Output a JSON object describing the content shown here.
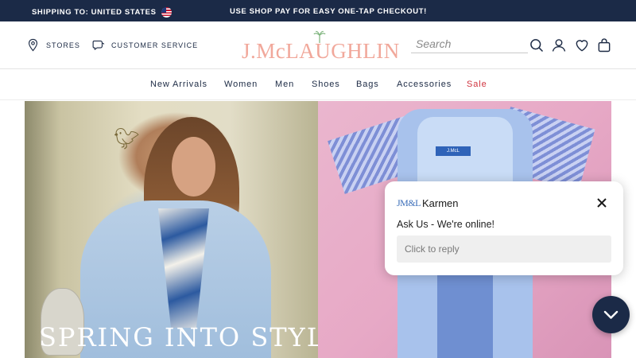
{
  "promo_bar": {
    "shipping_text": "SHIPPING TO: UNITED STATES",
    "flag_icon": "us-flag-icon",
    "shop_pay_text": "USE SHOP PAY FOR EASY ONE-TAP CHECKOUT!"
  },
  "header": {
    "stores_label": "STORES",
    "customer_service_label": "CUSTOMER SERVICE",
    "logo_text": "J.McLAUGHLIN",
    "search_placeholder": "Search",
    "icons": [
      "search-icon",
      "account-icon",
      "wishlist-heart-icon",
      "cart-bag-icon"
    ]
  },
  "nav": {
    "items": [
      {
        "label": "New Arrivals"
      },
      {
        "label": "Women"
      },
      {
        "label": "Men"
      },
      {
        "label": "Shoes"
      },
      {
        "label": "Bags"
      },
      {
        "label": "Accessories"
      },
      {
        "label": "Sale"
      }
    ]
  },
  "hero": {
    "left_title": "SPRING INTO STYLE"
  },
  "chat": {
    "brand_monogram": "JM&L",
    "agent_name": "Karmen",
    "message": "Ask Us - We're online!",
    "reply_placeholder": "Click to reply"
  },
  "colors": {
    "navy": "#1b2a47",
    "logo_coral": "#f1a89b",
    "sale_red": "#d0343f",
    "white": "#ffffff"
  }
}
